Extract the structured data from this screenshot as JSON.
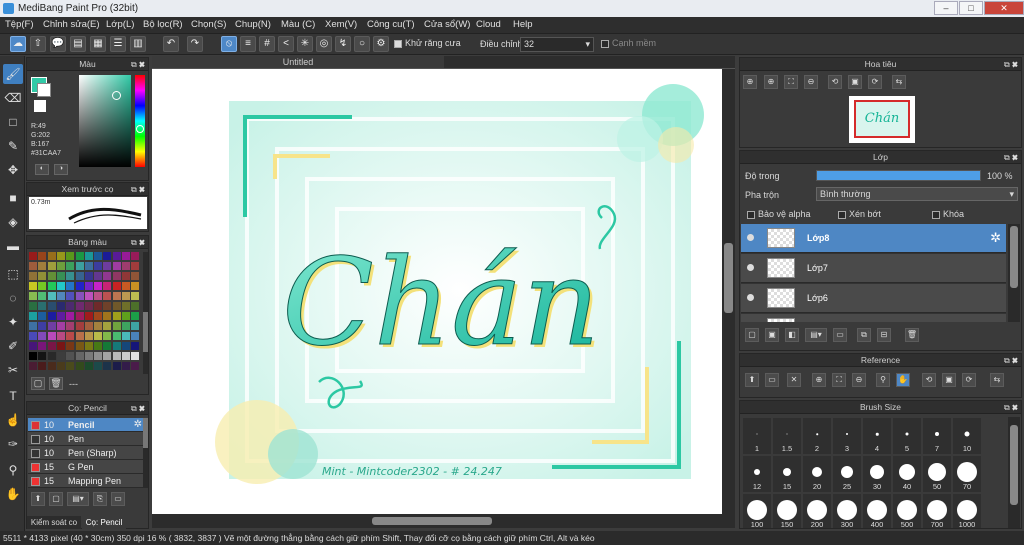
{
  "window": {
    "title": "MediBang Paint Pro (32bit)",
    "minimize": "–",
    "maximize": "□",
    "close": "✕"
  },
  "menu": [
    "Tệp(F)",
    "Chỉnh sửa(E)",
    "Lớp(L)",
    "Bộ lọc(R)",
    "Chọn(S)",
    "Chup(N)",
    "Màu (C)",
    "Xem(V)",
    "Công cu(T)",
    "Cửa sổ(W)",
    "Cloud",
    "Help"
  ],
  "toolbar": {
    "antialias_label": "Khử răng cưa",
    "adjust_label": "Điều chỉnh",
    "adjust_value": "32",
    "sharp_edge_label": "Cạnh mềm"
  },
  "canvas": {
    "tab_title": "Untitled",
    "art_text": "Chán",
    "signature": "Mint - Mintcoder2302 - # 24.247"
  },
  "color_panel": {
    "title": "Màu",
    "r": "R:49",
    "g": "G:202",
    "b": "B:167",
    "hex": "#31CAA7",
    "primary": "#31caa7"
  },
  "brush_preview": {
    "title": "Xem trước cọ",
    "size": "0.73m"
  },
  "palette": {
    "title": "Bảng màu",
    "footer": "---"
  },
  "brush_list": {
    "title": "Cọ: Pencil",
    "items": [
      {
        "size": "10",
        "name": "Pencil",
        "color": "#d33"
      },
      {
        "size": "10",
        "name": "Pen",
        "color": "#333"
      },
      {
        "size": "10",
        "name": "Pen (Sharp)",
        "color": "#333"
      },
      {
        "size": "15",
        "name": "G Pen",
        "color": "#e33"
      },
      {
        "size": "15",
        "name": "Mapping Pen",
        "color": "#e33"
      }
    ],
    "tab_control": "Kiểm soát co",
    "tab_brush": "Cọ: Pencil"
  },
  "navigator": {
    "title": "Hoa tiêu",
    "thumb_text": "Chán"
  },
  "layers": {
    "title": "Lớp",
    "opacity_label": "Độ trong",
    "opacity_value": "100 %",
    "opacity": 100,
    "blend_label": "Pha trộn",
    "blend_value": "Bình thường",
    "protect_alpha": "Bảo vệ alpha",
    "clipping": "Xén bớt",
    "lock": "Khóa",
    "items": [
      "Lớp8",
      "Lớp7",
      "Lớp6"
    ]
  },
  "reference": {
    "title": "Reference"
  },
  "brush_size": {
    "title": "Brush Size",
    "sizes": [
      "1",
      "1.5",
      "2",
      "3",
      "4",
      "5",
      "7",
      "10",
      "12",
      "15",
      "20",
      "25",
      "30",
      "40",
      "50",
      "70",
      "100",
      "150",
      "200",
      "300",
      "400",
      "500",
      "700",
      "1000"
    ]
  },
  "status": {
    "text": "5511 * 4133 pixel   (40 * 30cm)   350 dpi   16 %   ( 3832, 3837 )  Vẽ một đường thẳng bằng cách giữ phím Shift, Thay đổi cỡ cọ bằng cách giữ phím Ctrl, Alt và kéo"
  }
}
